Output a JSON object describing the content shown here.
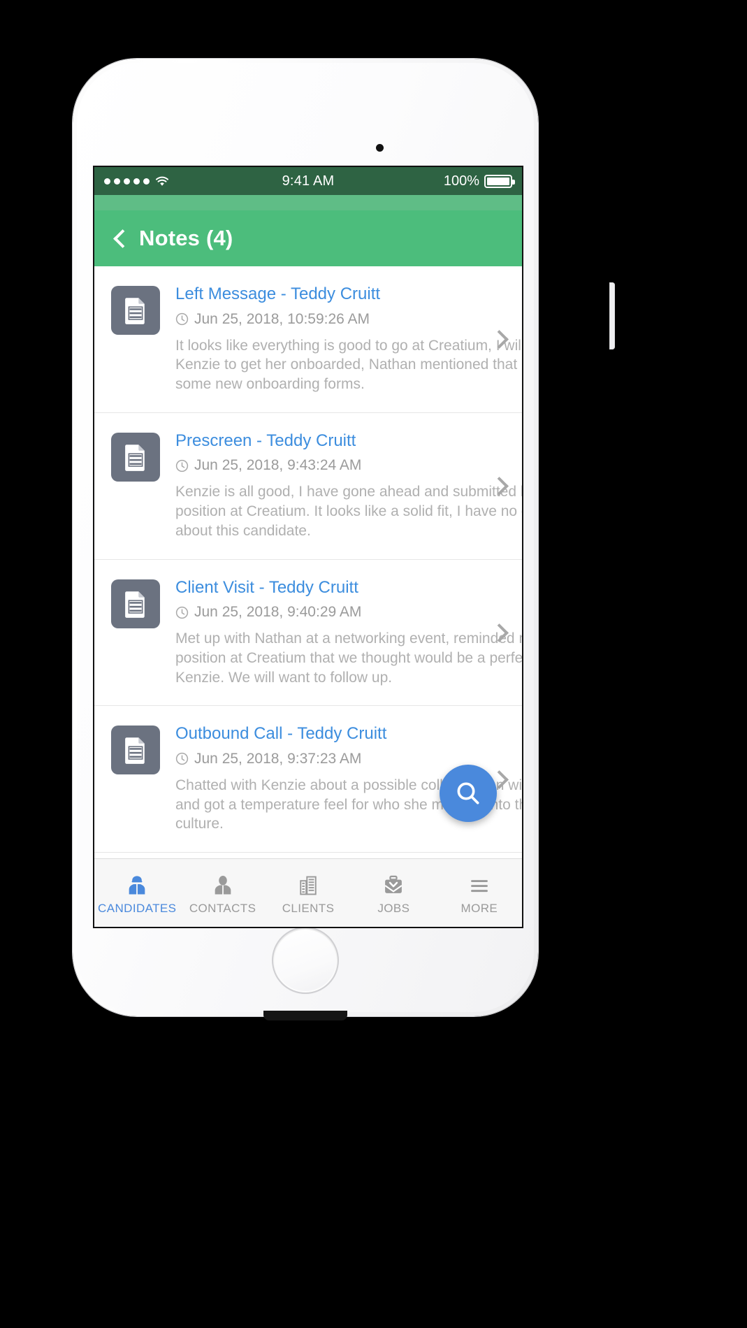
{
  "colors": {
    "status_bar_bg": "#2e6343",
    "nav_bar_bg": "#4cbd7c",
    "nav_strip_bg": "#5fbd86",
    "title_link": "#3c8dde",
    "accent_blue": "#4a89dc",
    "body_text": "#b0b0b0",
    "meta_text": "#9b9b9b",
    "icon_tile": "#6b7280"
  },
  "status_bar": {
    "signal_dots": 5,
    "wifi_icon": "wifi-icon",
    "time": "9:41 AM",
    "battery_percent": "100%",
    "battery_icon": "battery-full-icon"
  },
  "nav": {
    "back_icon": "chevron-left-icon",
    "title": "Notes (4)"
  },
  "notes": [
    {
      "icon": "document-icon",
      "title": "Left Message - Teddy Cruitt",
      "clock_icon": "clock-icon",
      "timestamp": "Jun 25, 2018, 10:59:26 AM",
      "text": "It looks like everything is good to go at Creatium, I will wo\nKenzie to get her onboarded, Nathan mentioned that Cre\nsome new onboarding forms.",
      "chevron": "chevron-right-icon"
    },
    {
      "icon": "document-icon",
      "title": "Prescreen - Teddy Cruitt",
      "clock_icon": "clock-icon",
      "timestamp": "Jun 25, 2018, 9:43:24 AM",
      "text": "Kenzie is all good, I have gone ahead and submitted her f\nposition at Creatium. It looks like a solid fit, I have no cor\nabout this candidate.",
      "chevron": "chevron-right-icon"
    },
    {
      "icon": "document-icon",
      "title": "Client Visit - Teddy Cruitt",
      "clock_icon": "clock-icon",
      "timestamp": "Jun 25, 2018, 9:40:29 AM",
      "text": "Met up with Nathan at a networking event, reminded me\nposition at Creatium that we thought would be a perfect\nKenzie. We will want to follow up.",
      "chevron": "chevron-right-icon"
    },
    {
      "icon": "document-icon",
      "title": "Outbound Call - Teddy Cruitt",
      "clock_icon": "clock-icon",
      "timestamp": "Jun 25, 2018, 9:37:23 AM",
      "text": "Chatted with Kenzie about a possible collaboration with \nand got a temperature feel for who she might fit into that\nculture.",
      "chevron": "chevron-right-icon"
    }
  ],
  "fab": {
    "icon": "search-icon",
    "label": "Search"
  },
  "tabs": [
    {
      "icon": "candidate-icon",
      "label": "CANDIDATES",
      "active": true
    },
    {
      "icon": "contact-icon",
      "label": "CONTACTS",
      "active": false
    },
    {
      "icon": "building-icon",
      "label": "CLIENTS",
      "active": false
    },
    {
      "icon": "briefcase-icon",
      "label": "JOBS",
      "active": false
    },
    {
      "icon": "hamburger-icon",
      "label": "MORE",
      "active": false
    }
  ]
}
